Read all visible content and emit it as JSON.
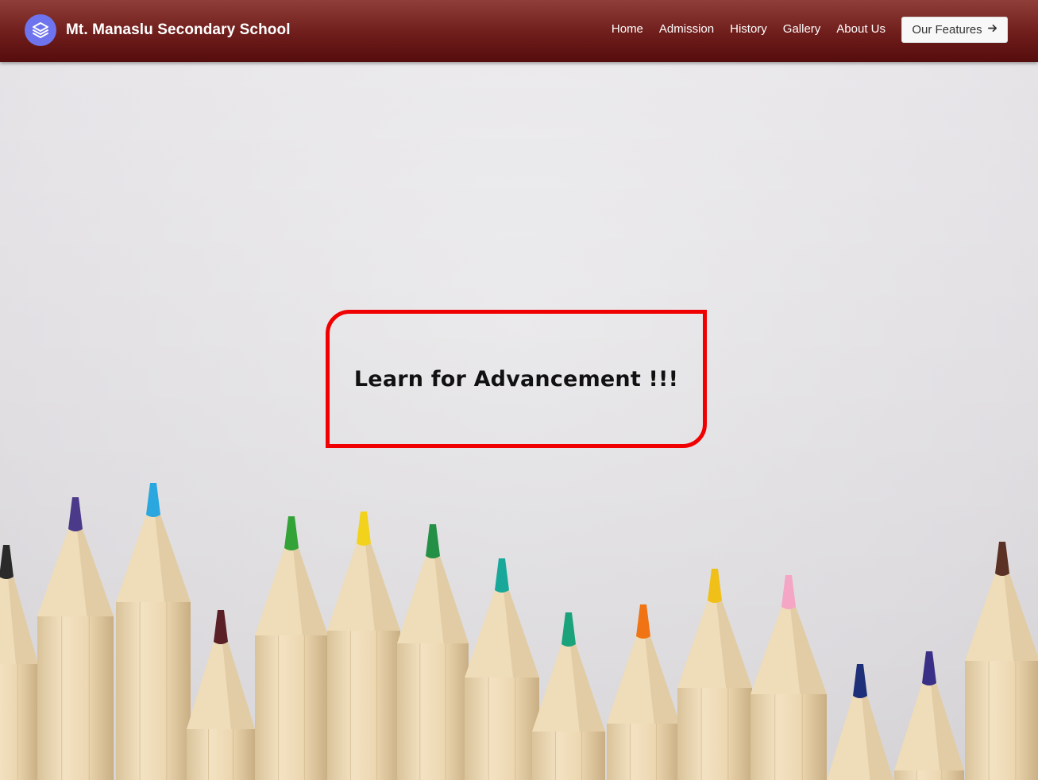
{
  "header": {
    "school_name": "Mt. Manaslu Secondary School",
    "logo_icon": "layers-icon",
    "nav": [
      {
        "label": "Home"
      },
      {
        "label": "Admission"
      },
      {
        "label": "History"
      },
      {
        "label": "Gallery"
      },
      {
        "label": "About Us"
      }
    ],
    "cta_label": "Our Features",
    "cta_icon": "arrow-right-icon"
  },
  "hero": {
    "tagline": "Learn for Advancement !!!",
    "accent_color": "#f00000",
    "background_image": "colored-pencils-photo"
  },
  "colors": {
    "navbar": "#6e1d1b",
    "logo_circle": "#6d74ee"
  }
}
